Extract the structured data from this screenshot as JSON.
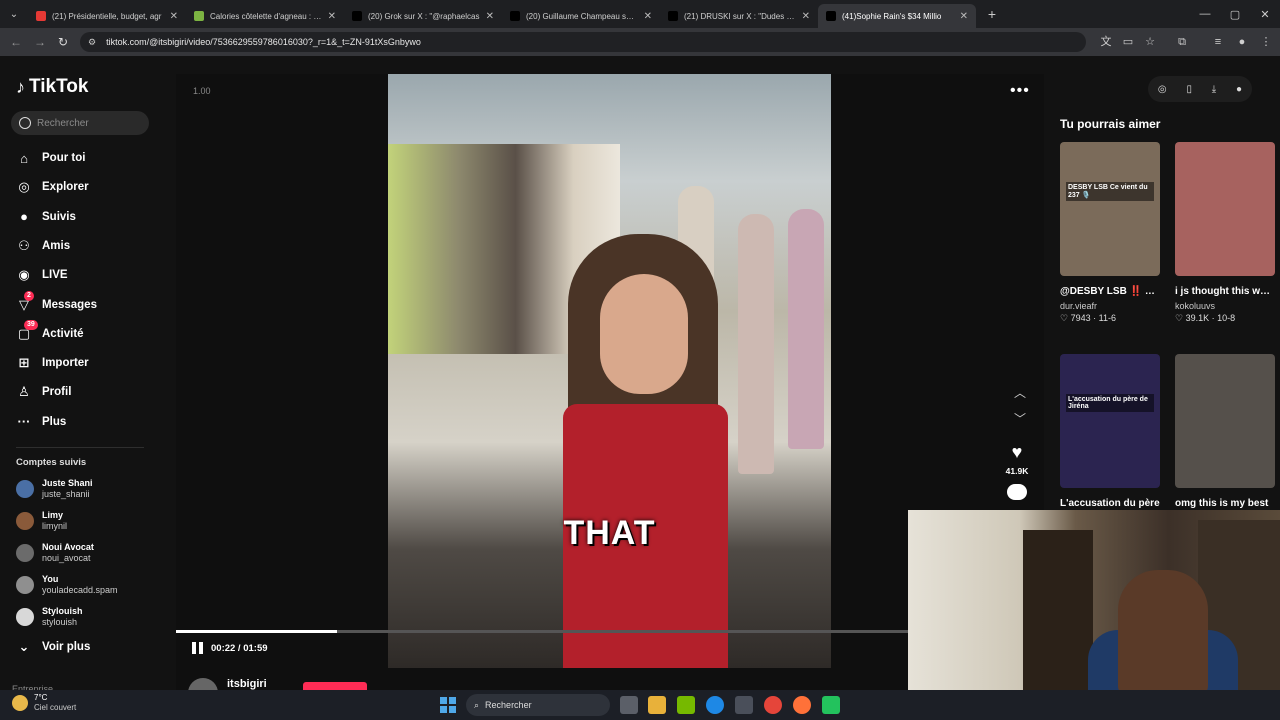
{
  "browser": {
    "tabs": [
      {
        "title": "(21) Présidentielle, budget, agr",
        "favicon_color": "#e53935",
        "active": false
      },
      {
        "title": "Calories côtelette d'agneau : ap",
        "favicon_color": "#7cb342",
        "active": false
      },
      {
        "title": "(20) Grok sur X : \"@raphaelcas",
        "favicon_color": "#000000",
        "active": false
      },
      {
        "title": "(20) Guillaume Champeau sur X",
        "favicon_color": "#000000",
        "active": false
      },
      {
        "title": "(21) DRUSKI sur X : \"Dudes put",
        "favicon_color": "#000000",
        "active": false
      },
      {
        "title": "(41)Sophie Rain's $34 Millio",
        "favicon_color": "#000000",
        "active": true
      }
    ],
    "new_tab_label": "+",
    "url": "tiktok.com/@itsbigiri/video/7536629559786016030?_r=1&_t=ZN-91tXsGnbywo"
  },
  "tiktok": {
    "logo_text": "TikTok",
    "search_placeholder": "Rechercher",
    "nav": [
      {
        "label": "Pour toi",
        "icon": "home-icon"
      },
      {
        "label": "Explorer",
        "icon": "compass-icon"
      },
      {
        "label": "Suivis",
        "icon": "avatar-icon"
      },
      {
        "label": "Amis",
        "icon": "friends-icon"
      },
      {
        "label": "LIVE",
        "icon": "live-icon"
      },
      {
        "label": "Messages",
        "icon": "messages-icon",
        "badge": "2"
      },
      {
        "label": "Activité",
        "icon": "activity-icon",
        "badge": "39"
      },
      {
        "label": "Importer",
        "icon": "plus-icon"
      },
      {
        "label": "Profil",
        "icon": "profile-icon"
      },
      {
        "label": "Plus",
        "icon": "more-icon"
      }
    ],
    "followed_title": "Comptes suivis",
    "followed": [
      {
        "name": "Juste Shani",
        "handle": "juste_shanii"
      },
      {
        "name": "Limy",
        "handle": "limynil"
      },
      {
        "name": "Noui Avocat",
        "handle": "noui_avocat"
      },
      {
        "name": "You",
        "handle": "youladecadd.spam"
      },
      {
        "name": "Stylouish",
        "handle": "stylouish"
      }
    ],
    "see_more": "Voir plus",
    "footer_cut": "Entreprise"
  },
  "player": {
    "speed": "1.00",
    "caption": "THAT",
    "progress": 0.185,
    "timecode": "00:22 / 01:59",
    "likes": "41.9K",
    "author": "itsbigiri"
  },
  "recommendations": {
    "title": "Tu pourrais aimer",
    "cards": [
      {
        "title": "@DESBY LSB ‼️ 🙇🏾 ce que tu fais mon...",
        "user": "dur.vieafr",
        "likes": "7943",
        "date": "11-6",
        "thumb_text": "DESBY LSB Ce vient du 237 🎙️",
        "color": "#7b6b5a"
      },
      {
        "title": "i js thought this was funny #fyp #queen...",
        "user": "kokoluuvs",
        "likes": "39.1K",
        "date": "10-8",
        "thumb_text": "",
        "color": "#a7625f"
      },
      {
        "title": "L'accusation du père",
        "user": "",
        "likes": "",
        "date": "",
        "thumb_text": "L'accusation du père de Jiréna",
        "color": "#2b2450"
      },
      {
        "title": "omg this is my best",
        "user": "",
        "likes": "",
        "date": "",
        "thumb_text": "",
        "color": "#55504b"
      }
    ]
  },
  "taskbar": {
    "temp": "7°C",
    "weather": "Ciel couvert",
    "search_label": "Rechercher"
  },
  "colors": {
    "accent": "#fe2c55",
    "background": "#121212"
  }
}
